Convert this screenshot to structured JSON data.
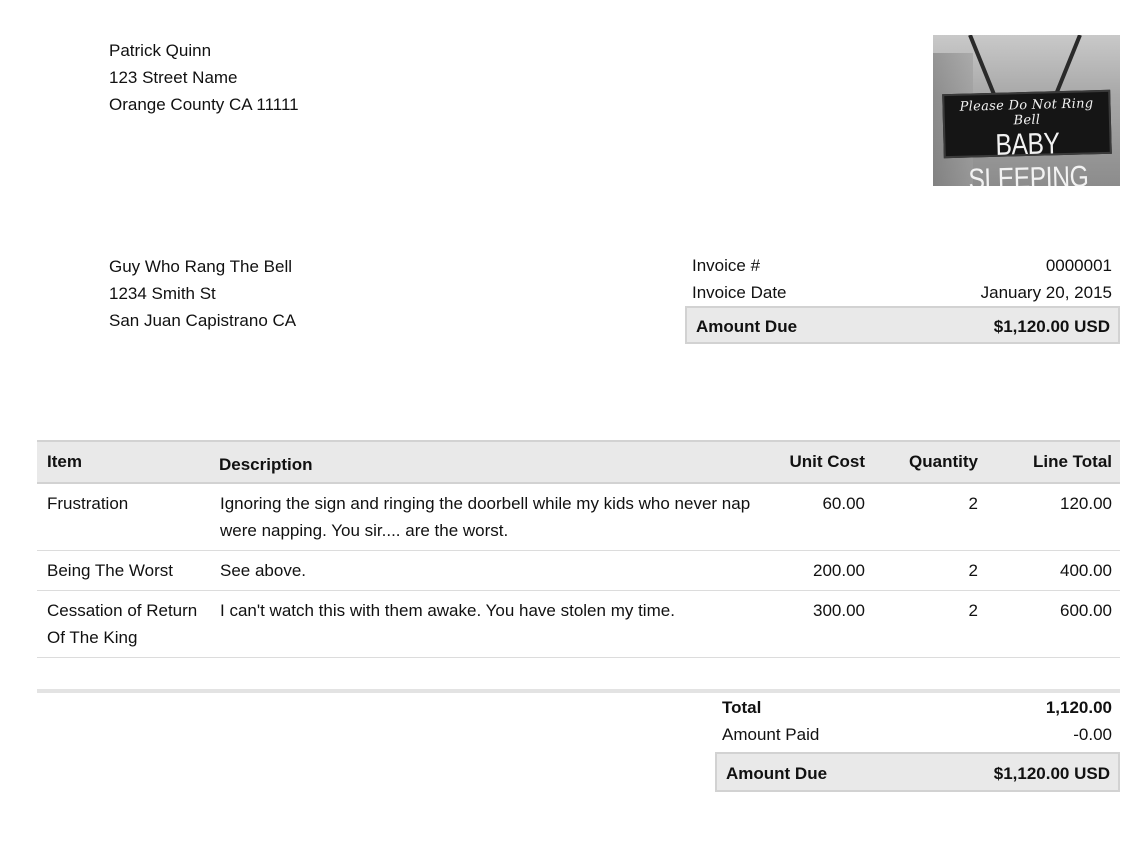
{
  "sender": {
    "name": "Patrick Quinn",
    "street": "123 Street Name",
    "city": "Orange County CA  11111"
  },
  "logo": {
    "top_text": "Please Do Not Ring Bell",
    "main_text": "BABY SLEEPING"
  },
  "recipient": {
    "name": "Guy Who Rang The Bell",
    "street": "1234 Smith St",
    "city": "San Juan Capistrano CA"
  },
  "meta": {
    "invoice_number_label": "Invoice #",
    "invoice_number": "0000001",
    "invoice_date_label": "Invoice Date",
    "invoice_date": "January 20, 2015",
    "amount_due_label": "Amount Due",
    "amount_due": "$1,120.00 USD"
  },
  "items": {
    "headers": {
      "item": "Item",
      "description": "Description",
      "unit_cost": "Unit Cost",
      "quantity": "Quantity",
      "line_total": "Line Total"
    },
    "rows": [
      {
        "item": "Frustration",
        "description": "Ignoring the sign and ringing the doorbell while my kids who never nap were napping. You sir.... are the worst.",
        "unit_cost": "60.00",
        "quantity": "2",
        "line_total": "120.00"
      },
      {
        "item": "Being The Worst",
        "description": "See above.",
        "unit_cost": "200.00",
        "quantity": "2",
        "line_total": "400.00"
      },
      {
        "item": "Cessation of Return Of The King",
        "description": "I can't watch this with them awake. You have stolen my time.",
        "unit_cost": "300.00",
        "quantity": "2",
        "line_total": "600.00"
      }
    ]
  },
  "totals": {
    "total_label": "Total",
    "total": "1,120.00",
    "paid_label": "Amount Paid",
    "paid": "-0.00",
    "due_label": "Amount Due",
    "due": "$1,120.00 USD"
  }
}
